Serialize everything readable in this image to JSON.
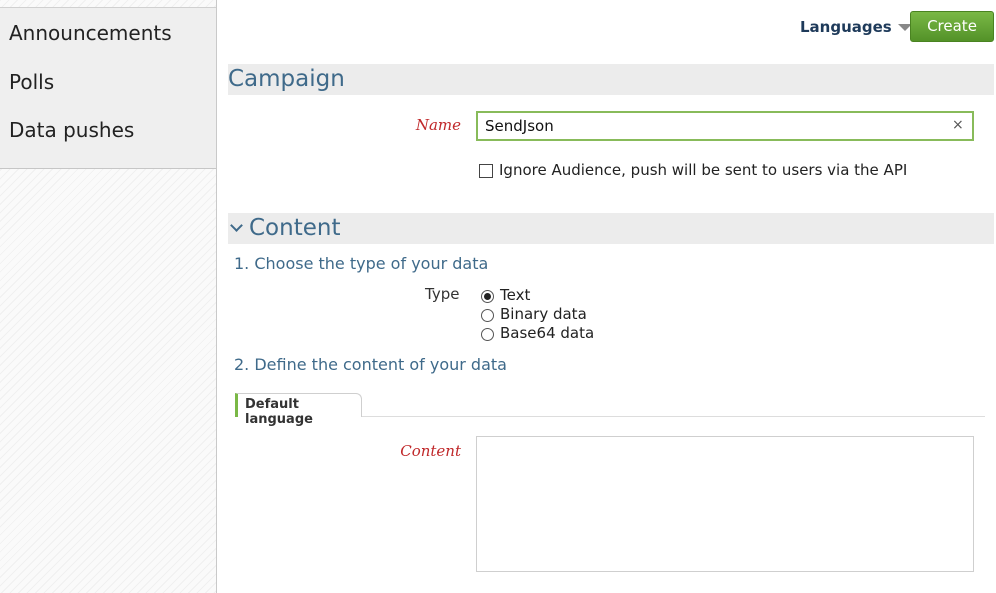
{
  "sidebar": {
    "items": [
      {
        "label": "Announcements"
      },
      {
        "label": "Polls"
      },
      {
        "label": "Data pushes"
      }
    ]
  },
  "header": {
    "languages_label": "Languages",
    "create_label": "Create"
  },
  "campaign": {
    "title": "Campaign",
    "name_label": "Name",
    "name_value": "SendJson",
    "clear_glyph": "×",
    "ignore_audience_label": "Ignore Audience, push will be sent to users via the API",
    "ignore_audience_checked": false
  },
  "content": {
    "title": "Content",
    "step1": "1. Choose the type of your data",
    "type_label": "Type",
    "type_options": [
      {
        "label": "Text",
        "checked": true
      },
      {
        "label": "Binary data",
        "checked": false
      },
      {
        "label": "Base64 data",
        "checked": false
      }
    ],
    "step2": "2. Define the content of your data",
    "tab_label": "Default language",
    "content_label": "Content",
    "content_value": ""
  },
  "colors": {
    "accent_green": "#6aa83a",
    "heading_blue": "#3f6a8a",
    "required_red": "#c0282a"
  }
}
